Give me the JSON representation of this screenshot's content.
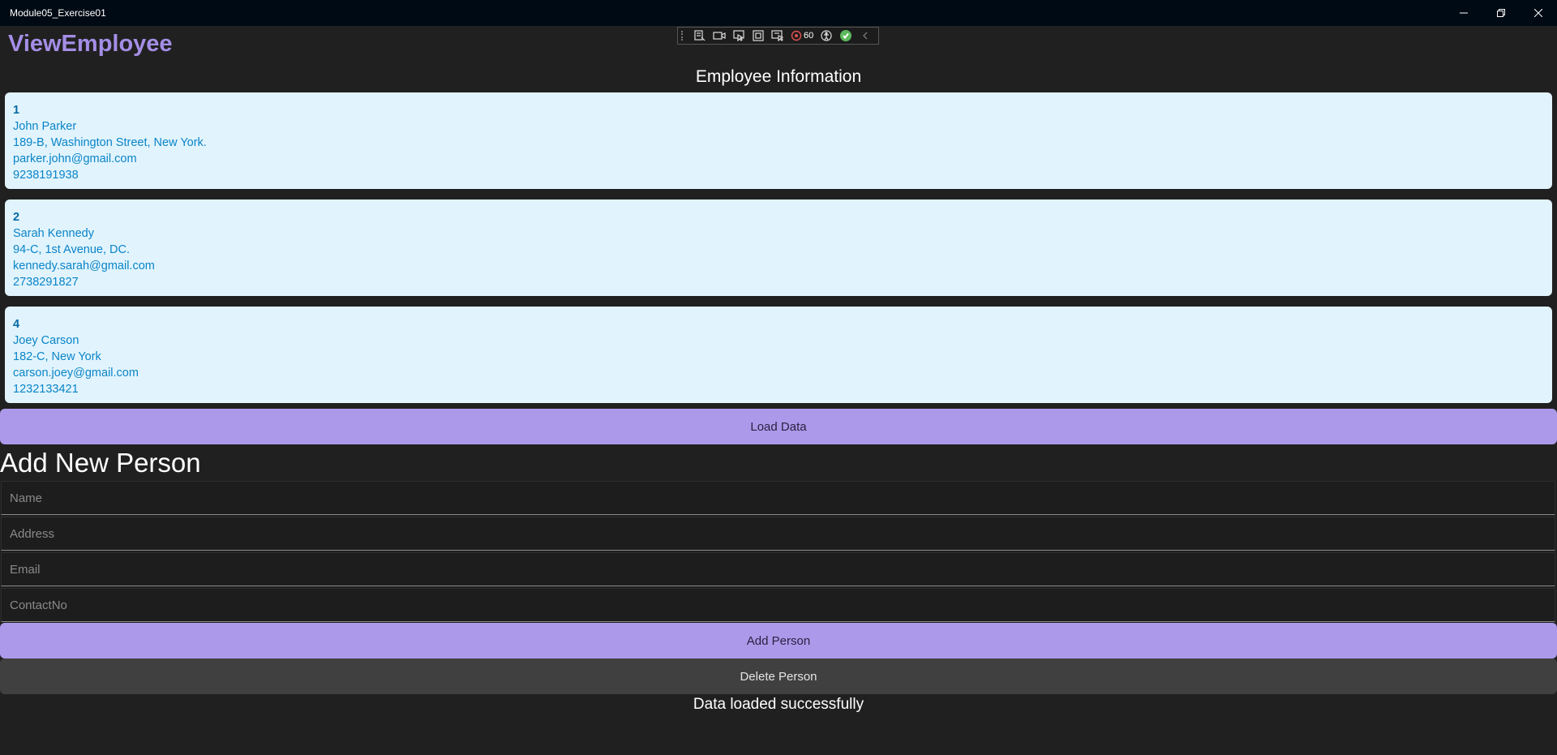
{
  "window": {
    "title": "Module05_Exercise01",
    "minimize_icon": "minimize-icon",
    "maximize_icon": "maximize-icon",
    "close_icon": "close-icon"
  },
  "app": {
    "title": "ViewEmployee",
    "accent_color": "#a48ee6"
  },
  "debug_toolbar": {
    "fps": "60",
    "icons": [
      "live-visual-tree-icon",
      "video-icon",
      "select-element-icon",
      "display-layout-adorners-icon",
      "track-focus-icon",
      "fps-icon",
      "accessibility-icon",
      "check-icon",
      "chevron-left-icon"
    ]
  },
  "employees": {
    "heading": "Employee Information",
    "list": [
      {
        "id": "1",
        "name": "John Parker",
        "address": "189-B, Washington Street, New York.",
        "email": "parker.john@gmail.com",
        "contact": "9238191938"
      },
      {
        "id": "2",
        "name": "Sarah Kennedy",
        "address": "94-C, 1st Avenue, DC.",
        "email": "kennedy.sarah@gmail.com",
        "contact": "2738291827"
      },
      {
        "id": "4",
        "name": "Joey Carson",
        "address": "182-C, New York",
        "email": "carson.joey@gmail.com",
        "contact": "1232133421"
      }
    ],
    "card_bg": "#e1f4fd",
    "card_text_color": "#0a84c8"
  },
  "actions": {
    "load_label": "Load Data",
    "add_label": "Add Person",
    "delete_label": "Delete Person"
  },
  "form": {
    "heading": "Add New Person",
    "name_placeholder": "Name",
    "name_value": "",
    "address_placeholder": "Address",
    "address_value": "",
    "email_placeholder": "Email",
    "email_value": "",
    "contact_placeholder": "ContactNo",
    "contact_value": ""
  },
  "status": {
    "message": "Data loaded successfully"
  }
}
